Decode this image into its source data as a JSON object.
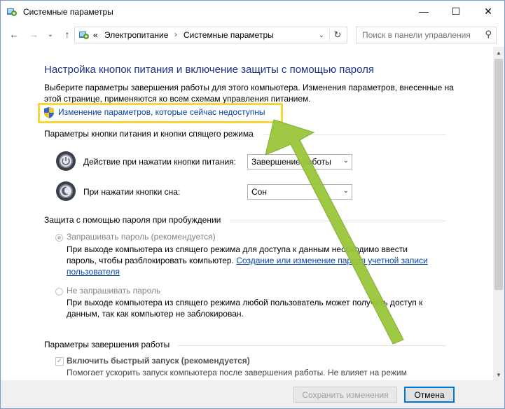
{
  "window": {
    "title": "Системные параметры",
    "minimize_glyph": "—",
    "maximize_glyph": "☐",
    "close_glyph": "✕"
  },
  "nav": {
    "back_glyph": "←",
    "forward_glyph": "→",
    "recent_glyph": "⌄",
    "up_glyph": "↑",
    "breadcrumb_overflow": "«",
    "breadcrumbs": [
      "Электропитание",
      "Системные параметры"
    ],
    "crumb_sep": "›",
    "refresh_glyph": "↻",
    "dropdown_glyph": "⌄"
  },
  "search": {
    "placeholder": "Поиск в панели управления",
    "icon_glyph": "⚲"
  },
  "content": {
    "title": "Настройка кнопок питания и включение защиты с помощью пароля",
    "description": "Выберите параметры завершения работы для этого компьютера. Изменения параметров, внесенные на этой странице, применяются ко всем схемам управления питанием.",
    "change_link": "Изменение параметров, которые сейчас недоступны",
    "buttons_section": {
      "heading": "Параметры кнопки питания и кнопки спящего режима",
      "power_label": "Действие при нажатии кнопки питания:",
      "power_value": "Завершение работы",
      "sleep_label": "При нажатии кнопки сна:",
      "sleep_value": "Сон"
    },
    "password_section": {
      "heading": "Защита с помощью пароля при пробуждении",
      "require_label": "Запрашивать пароль (рекомендуется)",
      "require_desc_1": "При выходе компьютера из спящего режима для доступа к данным необходимо ввести пароль, чтобы разблокировать компьютер.",
      "require_link": "Создание или изменение пароля учетной записи пользователя",
      "norequire_label": "Не запрашивать пароль",
      "norequire_desc": "При выходе компьютера из спящего режима любой пользователь может получить доступ к данным, так как компьютер не заблокирован."
    },
    "shutdown_section": {
      "heading": "Параметры завершения работы",
      "fast_startup_label": "Включить быстрый запуск (рекомендуется)",
      "fast_startup_desc": "Помогает ускорить запуск компьютера после завершения работы. Не влияет на режим"
    }
  },
  "footer": {
    "save_label": "Сохранить изменения",
    "cancel_label": "Отмена"
  },
  "colors": {
    "title_blue": "#1e3287",
    "link_blue": "#0645ad",
    "highlight_yellow": "#f7d737",
    "arrow_green": "#9ac63a"
  }
}
